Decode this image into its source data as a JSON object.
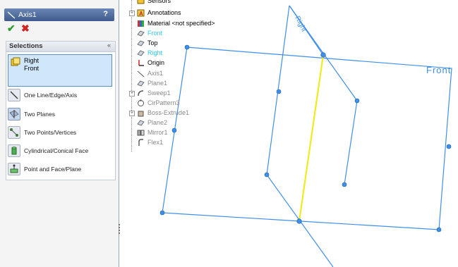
{
  "property_manager": {
    "title": "Axis1",
    "help_label": "?",
    "ok_symbol": "✔",
    "cancel_symbol": "✖",
    "selections": {
      "header": "Selections",
      "collapse_symbol": "«",
      "items": [
        "Right",
        "Front"
      ],
      "options": [
        {
          "label": "One Line/Edge/Axis",
          "icon": "line-axis-icon",
          "active": false
        },
        {
          "label": "Two Planes",
          "icon": "two-planes-icon",
          "active": true
        },
        {
          "label": "Two Points/Vertices",
          "icon": "two-points-icon",
          "active": false
        },
        {
          "label": "Cylindrical/Conical Face",
          "icon": "cylinder-face-icon",
          "active": false
        },
        {
          "label": "Point and Face/Plane",
          "icon": "point-face-icon",
          "active": false
        }
      ]
    }
  },
  "feature_tree": [
    {
      "label": "Sensors",
      "icon": "sensors-icon",
      "expander": "",
      "state": "normal"
    },
    {
      "label": "Annotations",
      "icon": "annotations-icon",
      "expander": "+",
      "state": "normal"
    },
    {
      "label": "Material <not specified>",
      "icon": "material-icon",
      "expander": "",
      "state": "normal"
    },
    {
      "label": "Front",
      "icon": "plane-icon",
      "expander": "",
      "state": "selected"
    },
    {
      "label": "Top",
      "icon": "plane-icon",
      "expander": "",
      "state": "normal"
    },
    {
      "label": "Right",
      "icon": "plane-icon",
      "expander": "",
      "state": "selected"
    },
    {
      "label": "Origin",
      "icon": "origin-icon",
      "expander": "",
      "state": "normal"
    },
    {
      "label": "Axis1",
      "icon": "axis-icon",
      "expander": "",
      "state": "dim"
    },
    {
      "label": "Plane1",
      "icon": "plane-icon",
      "expander": "",
      "state": "dim"
    },
    {
      "label": "Sweep1",
      "icon": "sweep-icon",
      "expander": "+",
      "state": "dim"
    },
    {
      "label": "CirPattern3",
      "icon": "pattern-icon",
      "expander": "",
      "state": "dim"
    },
    {
      "label": "Boss-Extrude1",
      "icon": "extrude-icon",
      "expander": "+",
      "state": "dim"
    },
    {
      "label": "Plane2",
      "icon": "plane-icon",
      "expander": "",
      "state": "dim"
    },
    {
      "label": "Mirror1",
      "icon": "mirror-icon",
      "expander": "",
      "state": "dim"
    },
    {
      "label": "Flex1",
      "icon": "flex-icon",
      "expander": "",
      "state": "dim"
    }
  ],
  "viewport": {
    "front_plane_label": "Front",
    "right_plane_label": "Right",
    "colors": {
      "plane_edge": "#3f8fe8",
      "axis_preview": "#f2ea20",
      "selected_text": "#2ec9f0",
      "dim_text": "#8a8a8a"
    }
  }
}
